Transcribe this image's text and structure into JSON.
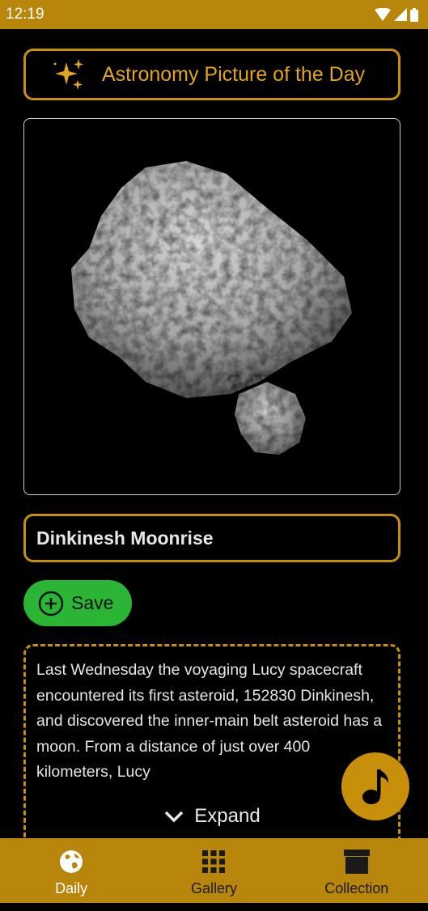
{
  "status": {
    "time": "12:19"
  },
  "header": {
    "title": "Astronomy Picture of the Day"
  },
  "picture": {
    "title": "Dinkinesh Moonrise"
  },
  "actions": {
    "save_label": "Save"
  },
  "description": {
    "text": "Last Wednesday the voyaging Lucy spacecraft encountered its first asteroid, 152830 Dinkinesh, and discovered the inner-main belt asteroid has a moon. From a distance of just over 400 kilometers, Lucy",
    "expand_label": "Expand"
  },
  "nav": {
    "items": [
      {
        "label": "Daily"
      },
      {
        "label": "Gallery"
      },
      {
        "label": "Collection"
      }
    ]
  },
  "colors": {
    "accent": "#c8900a",
    "bar": "#b8860b",
    "save": "#2bb534"
  }
}
